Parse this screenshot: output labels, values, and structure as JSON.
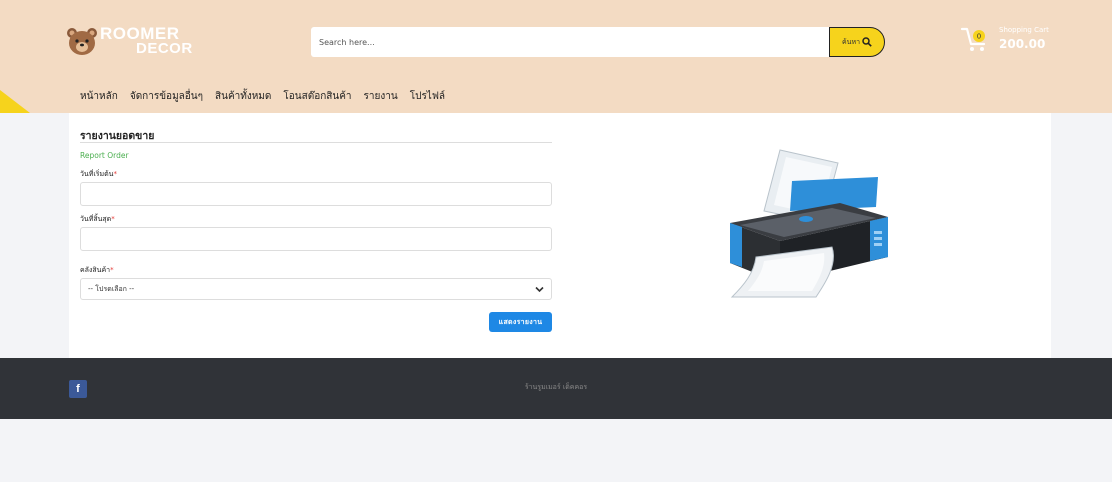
{
  "brand": {
    "line1": "ROOMER",
    "line2": "DECOR"
  },
  "search": {
    "placeholder": "Search here...",
    "button_label": "ค้นหา"
  },
  "cart": {
    "label": "Shopping Cart",
    "total": "200.00",
    "count": "0"
  },
  "nav": {
    "items": [
      {
        "label": "หน้าหลัก"
      },
      {
        "label": "จัดการข้อมูลอื่นๆ"
      },
      {
        "label": "สินค้าทั้งหมด"
      },
      {
        "label": "โอนสต๊อกสินค้า"
      },
      {
        "label": "รายงาน"
      },
      {
        "label": "โปรไฟล์"
      }
    ]
  },
  "form": {
    "title": "รายงานยอดขาย",
    "subtitle": "Report Order",
    "start_date_label": "วันที่เริ่มต้น",
    "end_date_label": "วันที่สิ้นสุด",
    "warehouse_label": "คลังสินค้า",
    "required_mark": "*",
    "warehouse_selected": "-- โปรดเลือก --",
    "submit_label": "แสดงรายงาน"
  },
  "footer": {
    "facebook_glyph": "f",
    "copyright": "ร้านรูมเมอร์ เด็คคอร"
  },
  "colors": {
    "header_bg": "#f3dbc3",
    "search_button": "#f6d31c",
    "primary_button": "#1e88e5",
    "footer_bg": "#303338",
    "facebook": "#3b5998",
    "subtitle_green": "#4caf50"
  }
}
